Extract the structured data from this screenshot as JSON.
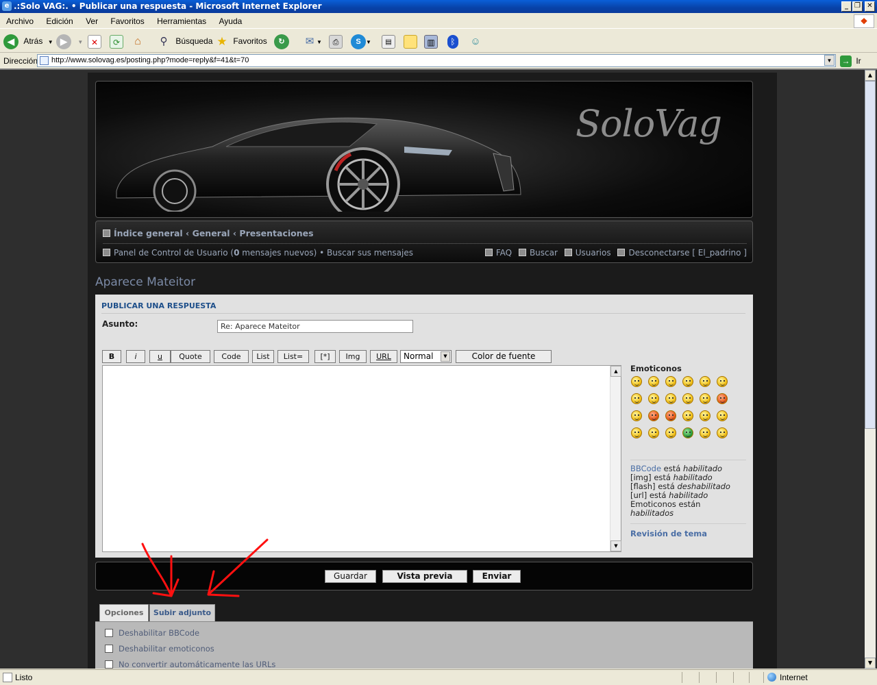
{
  "window": {
    "title": ".:Solo VAG:. • Publicar una respuesta - Microsoft Internet Explorer"
  },
  "menu": [
    "Archivo",
    "Edición",
    "Ver",
    "Favoritos",
    "Herramientas",
    "Ayuda"
  ],
  "toolbar": {
    "back_label": "Atrás",
    "search_label": "Búsqueda",
    "favorites_label": "Favoritos"
  },
  "address": {
    "label": "Dirección",
    "url": "http://www.solovag.es/posting.php?mode=reply&f=41&t=70",
    "go_label": "Ir"
  },
  "site": {
    "logo_text": "SoloVag",
    "breadcrumbs": "Índice general ‹ General ‹ Presentaciones",
    "ucp_prefix": "Panel de Control de Usuario (",
    "new_messages_count": "0",
    "ucp_suffix": " mensajes nuevos) • Buscar sus mensajes",
    "nav_faq": "FAQ",
    "nav_search": "Buscar",
    "nav_users": "Usuarios",
    "nav_logout": "Desconectarse [ El_padrino ]"
  },
  "topic": {
    "title": "Aparece Mateitor"
  },
  "post_form": {
    "heading": "PUBLICAR UNA RESPUESTA",
    "subject_label": "Asunto:",
    "subject_value": "Re: Aparece Mateitor",
    "bbcode_buttons": [
      "B",
      "i",
      "u",
      "Quote",
      "Code",
      "List",
      "List=",
      "[*]",
      "Img",
      "URL"
    ],
    "font_size": "Normal",
    "font_color_label": "Color de fuente",
    "message": ""
  },
  "sidebar": {
    "emoticons_title": "Emoticonos",
    "bbcode_link": "BBCode",
    "status": [
      {
        "prefix": "",
        "mid": " está ",
        "state": "habilitado"
      },
      {
        "prefix": "[img]",
        "mid": " está ",
        "state": "habilitado"
      },
      {
        "prefix": "[flash]",
        "mid": " está ",
        "state": "deshabilitado"
      },
      {
        "prefix": "[url]",
        "mid": " está ",
        "state": "habilitado"
      },
      {
        "prefix": "Emoticonos",
        "mid": " están ",
        "state": "habilitados"
      }
    ],
    "review_title": "Revisión de tema"
  },
  "actions": {
    "save": "Guardar",
    "preview": "Vista previa",
    "submit": "Enviar"
  },
  "tabs": {
    "options": "Opciones",
    "attach": "Subir adjunto"
  },
  "options": [
    "Deshabilitar BBCode",
    "Deshabilitar emoticonos",
    "No convertir automáticamente las URLs"
  ],
  "statusbar": {
    "status": "Listo",
    "zone": "Internet"
  }
}
